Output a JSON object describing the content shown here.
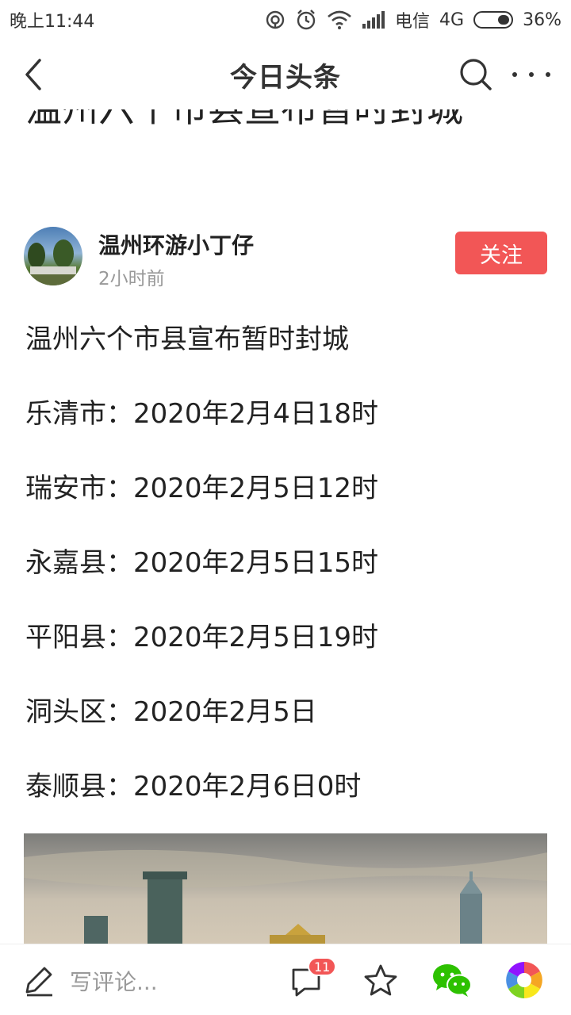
{
  "status_bar": {
    "time": "晚上11:44",
    "carrier": "电信",
    "network": "4G",
    "battery": "36%",
    "battery_level": 0.36,
    "icons": [
      "hotspot-icon",
      "alarm-icon",
      "wifi-icon",
      "signal-icon",
      "battery-icon"
    ]
  },
  "nav": {
    "title": "今日头条",
    "icons": [
      "back-icon",
      "search-icon",
      "more-icon"
    ]
  },
  "article": {
    "headline": "温州六个市县宣布暂时封城",
    "author": {
      "name": "温州环游小丁仔",
      "time": "2小时前",
      "follow_label": "关注"
    },
    "paragraphs": [
      "温州六个市县宣布暂时封城",
      "乐清市：2020年2月4日18时",
      "瑞安市：2020年2月5日12时",
      "永嘉县：2020年2月5日15时",
      "平阳县：2020年2月5日19时",
      "洞头区：2020年2月5日",
      "泰顺县：2020年2月6日0时"
    ]
  },
  "bottom_bar": {
    "comment_placeholder": "写评论...",
    "comment_count": "11",
    "icons": [
      "pen-icon",
      "comment-icon",
      "star-icon",
      "wechat-icon",
      "moments-icon"
    ]
  },
  "colors": {
    "accent": "#f25656",
    "text": "#222222",
    "muted": "#999999"
  }
}
